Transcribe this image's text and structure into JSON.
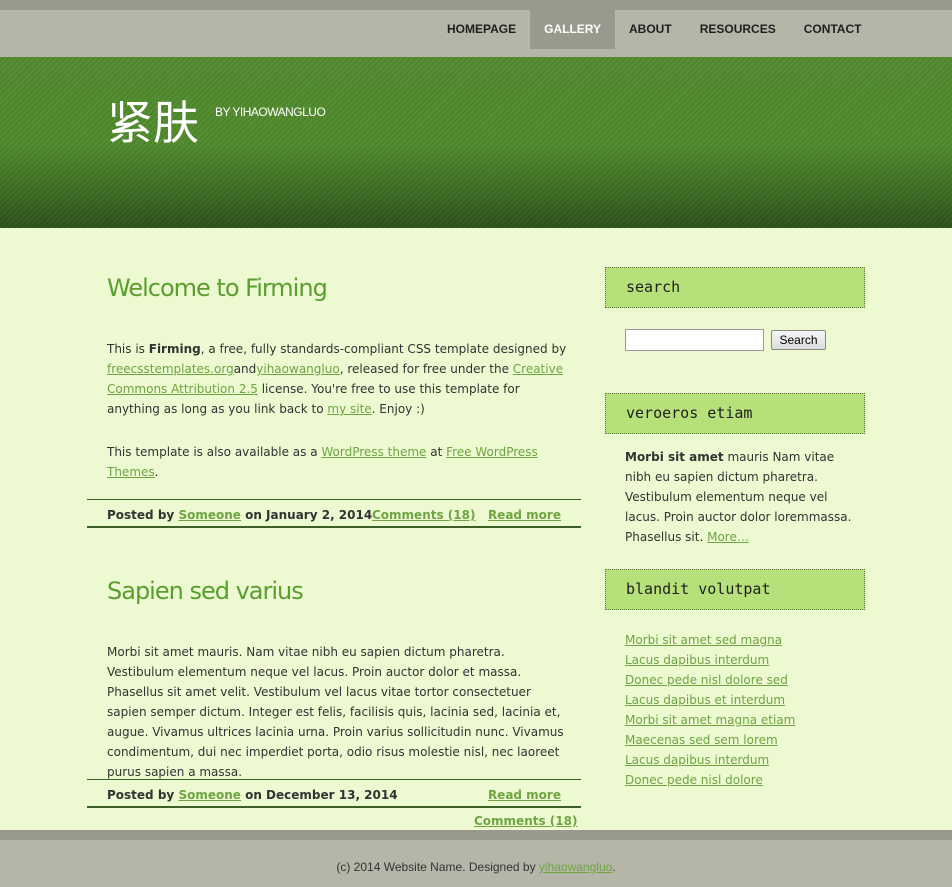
{
  "nav": {
    "items": [
      {
        "label": "HOMEPAGE"
      },
      {
        "label": "GALLERY"
      },
      {
        "label": "ABOUT"
      },
      {
        "label": "RESOURCES"
      },
      {
        "label": "CONTACT"
      }
    ],
    "active": "GALLERY"
  },
  "header": {
    "title": "紧肤",
    "subtitle": "BY YIHAOWANGLUO"
  },
  "posts": [
    {
      "title": "Welcome to Firming",
      "p1": {
        "t1": "This is ",
        "strong": "Firming",
        "t2": ", a free, fully standards-compliant CSS template designed by ",
        "link1": "freecsstemplates.org",
        "t3": "and",
        "link2": "yihaowangluo",
        "t4": ", released for free under the ",
        "link3": "Creative Commons Attribution 2.5",
        "t5": " license. You're free to use this template for anything as long as you link back to ",
        "link4": "my site",
        "t6": ". Enjoy :)"
      },
      "p2": {
        "t1": "This template is also available as a ",
        "link1": "WordPress theme",
        "t2": " at ",
        "link2": "Free WordPress Themes",
        "t3": "."
      },
      "meta": {
        "posted_by": "Posted by",
        "author": "Someone",
        "date": "on January 2, 2014",
        "comments": "Comments (18)",
        "read_more": "Read more"
      }
    },
    {
      "title": "Sapien sed varius",
      "body": "Morbi sit amet mauris. Nam vitae nibh eu sapien dictum pharetra. Vestibulum elementum neque vel lacus. Proin auctor dolor et massa. Phasellus sit amet velit. Vestibulum vel lacus vitae tortor consectetuer sapien semper dictum. Integer est felis, facilisis quis, lacinia sed, lacinia et, augue. Vivamus ultrices lacinia urna. Proin varius sollicitudin nunc. Vivamus condimentum, dui nec imperdiet porta, odio risus molestie nisl, nec laoreet purus sapien a massa.",
      "meta": {
        "posted_by": "Posted by",
        "author": "Someone",
        "date": "on December 13, 2014",
        "read_more": "Read more",
        "comments": "Comments (18)"
      }
    }
  ],
  "sidebar": {
    "search": {
      "heading": "search",
      "input_value": "",
      "button": "Search"
    },
    "box2": {
      "heading": "veroeros etiam",
      "strong": "Morbi sit amet",
      "text": " mauris Nam vitae nibh eu sapien dictum pharetra. Vestibulum elementum neque vel lacus. Proin auctor dolor loremmassa. Phasellus sit. ",
      "more": "More…"
    },
    "box3": {
      "heading": "blandit volutpat",
      "links": [
        "Morbi sit amet sed magna",
        "Lacus dapibus interdum",
        "Donec pede nisl dolore sed",
        "Lacus dapibus et interdum",
        "Morbi sit amet magna etiam",
        "Maecenas sed sem lorem",
        "Lacus dapibus interdum",
        "Donec pede nisl dolore"
      ]
    }
  },
  "footer": {
    "text": "(c) 2014 Website Name. Designed by ",
    "link": "yihaowangluo",
    "end": "."
  },
  "colors": {
    "page_bg": "#ecf9d1",
    "nav_bg": "#b5b6a8",
    "nav_active_bg": "#999a8d",
    "header_green": "#4f8a2c",
    "title_green": "#5a9e2e",
    "link_green": "#6ea542",
    "sidebar_heading_bg": "#b6e07a"
  }
}
